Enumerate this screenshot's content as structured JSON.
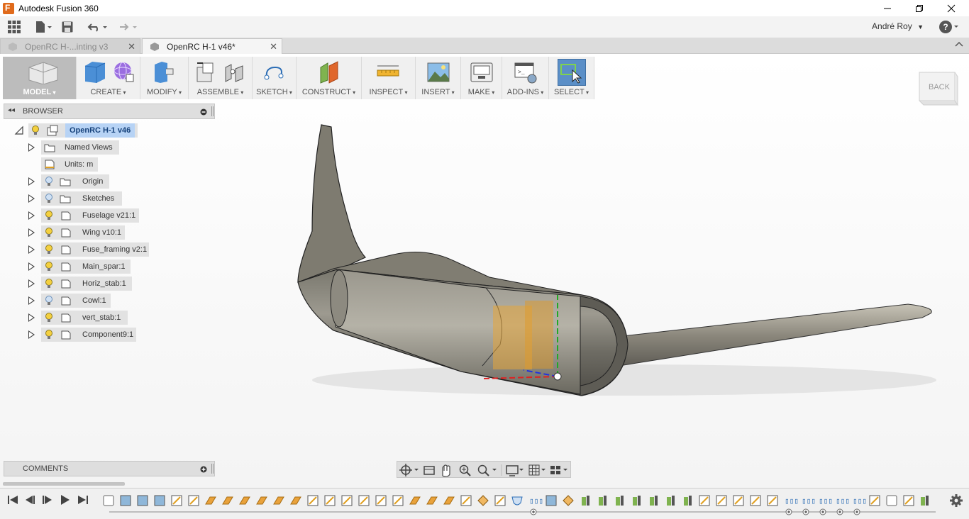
{
  "window": {
    "title": "Autodesk Fusion 360",
    "controls": [
      "minimize",
      "restore",
      "close"
    ]
  },
  "quick_access": {
    "user": "André Roy"
  },
  "tabs": [
    {
      "label": "OpenRC H-...inting v3",
      "active": false
    },
    {
      "label": "OpenRC H-1 v46*",
      "active": true
    }
  ],
  "ribbon": {
    "workspace": "MODEL",
    "groups": [
      {
        "label": "CREATE"
      },
      {
        "label": "MODIFY"
      },
      {
        "label": "ASSEMBLE"
      },
      {
        "label": "SKETCH"
      },
      {
        "label": "CONSTRUCT"
      },
      {
        "label": "INSPECT"
      },
      {
        "label": "INSERT"
      },
      {
        "label": "MAKE"
      },
      {
        "label": "ADD-INS"
      },
      {
        "label": "SELECT"
      }
    ]
  },
  "viewcube": {
    "face": "BACK"
  },
  "browser": {
    "title": "BROWSER",
    "root": "OpenRC H-1 v46",
    "items": [
      {
        "label": "Named Views",
        "type": "folder"
      },
      {
        "label": "Units: m",
        "type": "units"
      },
      {
        "label": "Origin",
        "type": "folder",
        "visible": false
      },
      {
        "label": "Sketches",
        "type": "folder",
        "visible": false
      },
      {
        "label": "Fuselage v21:1",
        "type": "component",
        "visible": true
      },
      {
        "label": "Wing v10:1",
        "type": "component",
        "visible": true
      },
      {
        "label": "Fuse_framing v2:1",
        "type": "component",
        "visible": true
      },
      {
        "label": "Main_spar:1",
        "type": "component",
        "visible": true
      },
      {
        "label": "Horiz_stab:1",
        "type": "component",
        "visible": true
      },
      {
        "label": "Cowl:1",
        "type": "component",
        "visible": false
      },
      {
        "label": "vert_stab:1",
        "type": "component",
        "visible": true
      },
      {
        "label": "Component9:1",
        "type": "component",
        "visible": true
      }
    ]
  },
  "comments": {
    "title": "COMMENTS"
  },
  "colors": {
    "accent": "#5b8fc7",
    "bulb_on": "#f4d03f",
    "bulb_off": "#8fb3d9",
    "selection_highlight": "#b7d3f5"
  }
}
